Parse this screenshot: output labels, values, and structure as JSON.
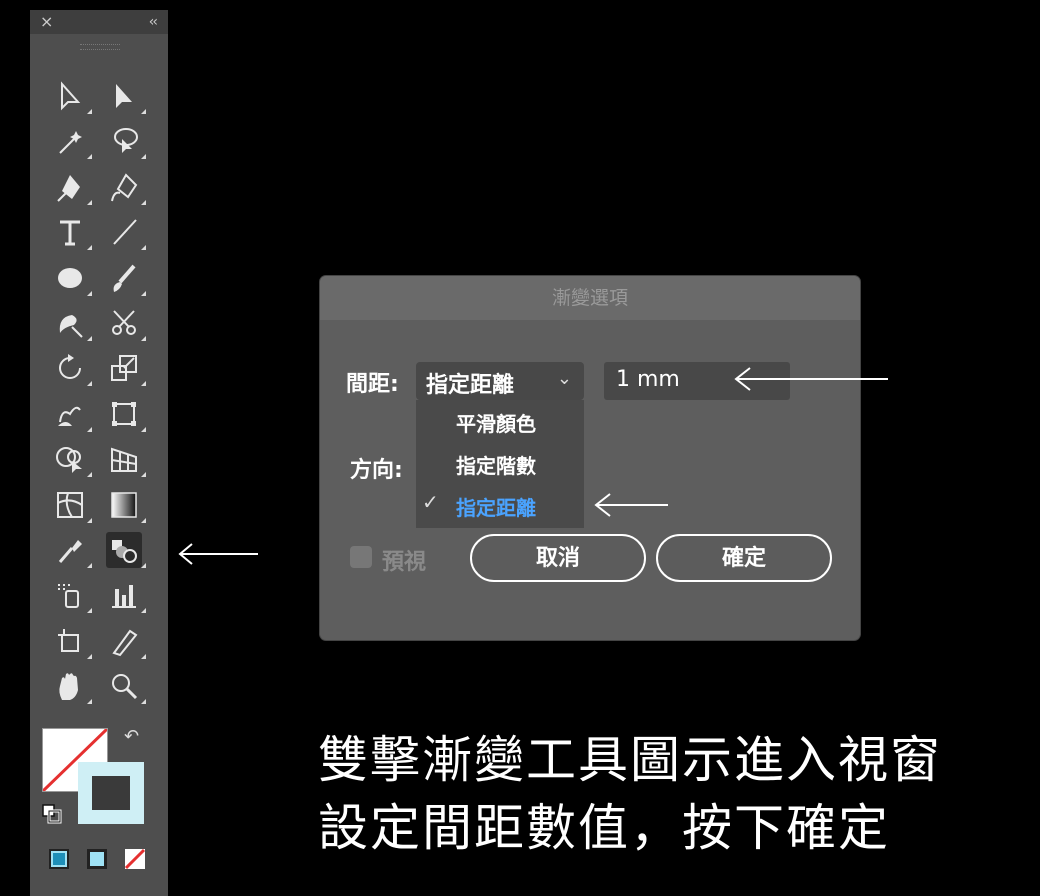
{
  "toolbar": {
    "close_glyph": "×",
    "collapse_glyph": "‹‹",
    "tools": [
      {
        "name": "selection-icon"
      },
      {
        "name": "direct-selection-icon"
      },
      {
        "name": "magic-wand-icon"
      },
      {
        "name": "lasso-icon"
      },
      {
        "name": "pen-icon"
      },
      {
        "name": "curvature-pen-icon"
      },
      {
        "name": "type-icon"
      },
      {
        "name": "line-segment-icon"
      },
      {
        "name": "ellipse-icon"
      },
      {
        "name": "paintbrush-icon"
      },
      {
        "name": "shaper-icon"
      },
      {
        "name": "scissors-icon"
      },
      {
        "name": "rotate-icon"
      },
      {
        "name": "scale-icon"
      },
      {
        "name": "warp-icon"
      },
      {
        "name": "free-transform-icon"
      },
      {
        "name": "shape-builder-icon"
      },
      {
        "name": "perspective-grid-icon"
      },
      {
        "name": "mesh-icon"
      },
      {
        "name": "gradient-icon"
      },
      {
        "name": "eyedropper-icon"
      },
      {
        "name": "blend-icon"
      },
      {
        "name": "symbol-sprayer-icon"
      },
      {
        "name": "column-graph-icon"
      },
      {
        "name": "artboard-icon"
      },
      {
        "name": "slice-icon"
      },
      {
        "name": "hand-icon"
      },
      {
        "name": "zoom-icon"
      }
    ],
    "active_tool": "blend-icon"
  },
  "dialog": {
    "title": "漸變選項",
    "spacing_label": "間距:",
    "spacing_selected": "指定距離",
    "spacing_value": "1 mm",
    "orientation_label": "方向:",
    "menu_items": [
      "平滑顏色",
      "指定階數",
      "指定距離"
    ],
    "menu_selected": "指定距離",
    "preview_label": "預視",
    "cancel_label": "取消",
    "ok_label": "確定"
  },
  "caption": {
    "line1": "雙擊漸變工具圖示進入視窗",
    "line2": "設定間距數值，按下確定"
  },
  "colors": {
    "accent_blue": "#4aa3ff",
    "none_red": "#e53030",
    "stroke_fill": "#cfeff5"
  }
}
